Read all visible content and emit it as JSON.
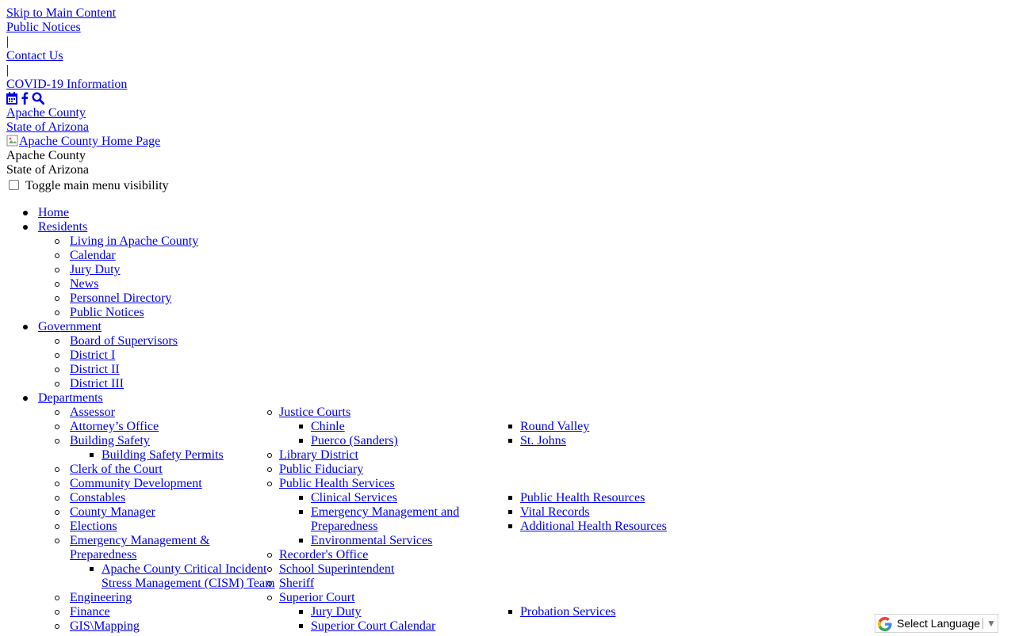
{
  "top": {
    "skip": "Skip to Main Content",
    "public_notices": "Public Notices",
    "sep": "|",
    "contact_us": "Contact Us",
    "covid": "COVID-19 Information",
    "icons": [
      "calendar-icon",
      "facebook-icon",
      "search-icon"
    ]
  },
  "brand": {
    "county_link": "Apache County",
    "state_link": "State of Arizona",
    "home_image_alt": "Apache County Home Page",
    "county_text": "Apache County",
    "state_text": "State of Arizona"
  },
  "menu_toggle": {
    "label": "Toggle main menu visibility",
    "checked": false
  },
  "nav": {
    "home": "Home",
    "residents": {
      "label": "Residents",
      "items": [
        "Living in Apache County",
        "Calendar",
        "Jury Duty",
        "News",
        "Personnel Directory",
        "Public Notices"
      ]
    },
    "government": {
      "label": "Government",
      "items": [
        "Board of Supervisors",
        "District I",
        "District II",
        "District III"
      ]
    },
    "departments": {
      "label": "Departments",
      "col1": {
        "assessor": "Assessor",
        "attorney": "Attorney’s Office",
        "building_safety": "Building Safety",
        "building_safety_permits": "Building Safety Permits",
        "clerk": "Clerk of the Court",
        "community_dev": "Community Development",
        "constables": "Constables",
        "county_manager": "County Manager",
        "elections": "Elections",
        "emergency_line1": "Emergency Management &",
        "emergency_line2": "Preparedness",
        "cism_line1": "Apache County Critical Incident",
        "cism_line2": "Stress Management (CISM) Team",
        "engineering": "Engineering",
        "finance": "Finance",
        "gis": "GIS\\Mapping"
      },
      "col2": {
        "justice_courts": "Justice Courts",
        "chinle": "Chinle",
        "puerco": "Puerco (Sanders)",
        "library": "Library District",
        "fiduciary": "Public Fiduciary",
        "health": "Public Health Services",
        "clinical": "Clinical Services",
        "em_prep_line1": "Emergency Management and",
        "em_prep_line2": "Preparedness",
        "environmental": "Environmental Services",
        "recorder": "Recorder's Office",
        "school": "School Superintendent",
        "sheriff": "Sheriff",
        "superior": "Superior Court",
        "jury": "Jury Duty",
        "calendar": "Superior Court Calendar"
      },
      "col3": {
        "round_valley": "Round Valley",
        "st_johns": "St. Johns",
        "health_resources": "Public Health Resources",
        "vital": "Vital Records",
        "additional": "Additional Health Resources",
        "probation": "Probation Services"
      }
    }
  },
  "translate": {
    "label": "Select Language",
    "arrow": "▼"
  }
}
